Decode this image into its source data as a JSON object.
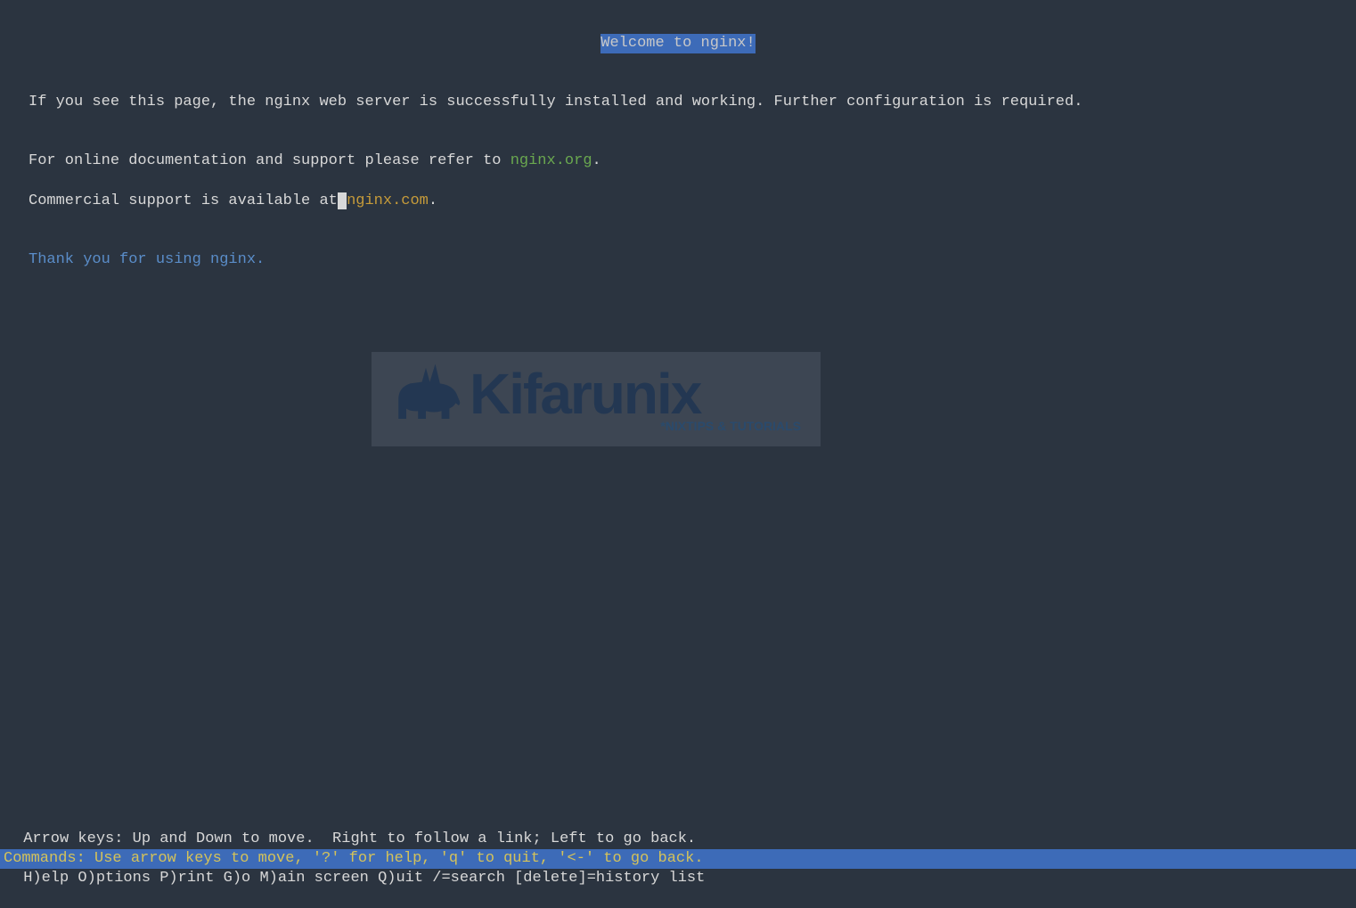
{
  "page": {
    "title": "Welcome to nginx!",
    "body_para1": "If you see this page, the nginx web server is successfully installed and working. Further configuration is required.",
    "doc_line_pre": "For online documentation and support please refer to ",
    "doc_link": "nginx.org",
    "doc_line_post": ".",
    "commercial_pre": "Commercial support is available at",
    "cursor_char": " ",
    "commercial_link": "nginx.com",
    "commercial_post": ".",
    "thanks": "Thank you for using nginx."
  },
  "watermark": {
    "brand": "Kifarunix",
    "tagline": "*NIXTIPS & TUTORIALS"
  },
  "status": {
    "commands": "Commands: Use arrow keys to move, '?' for help, 'q' to quit, '<-' to go back.",
    "help1": " Arrow keys: Up and Down to move.  Right to follow a link; Left to go back.",
    "help2": " H)elp O)ptions P)rint G)o M)ain screen Q)uit /=search [delete]=history list"
  }
}
